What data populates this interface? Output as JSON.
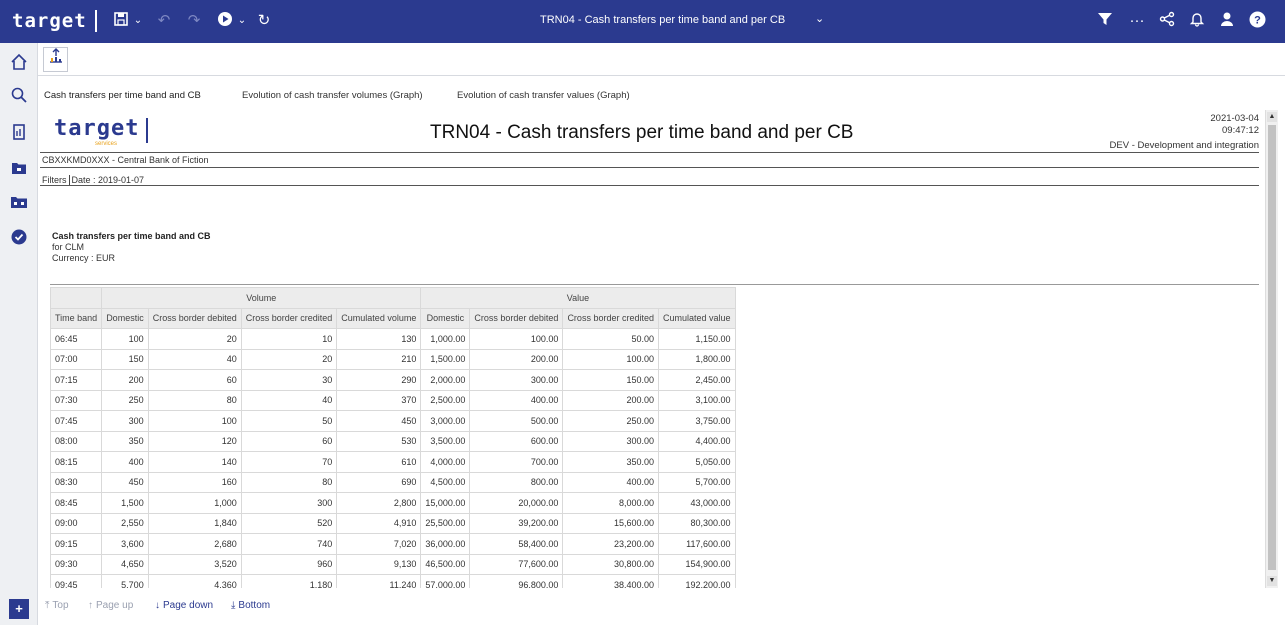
{
  "app": {
    "brand": "target",
    "document_title": "TRN04 - Cash transfers per time band and per CB"
  },
  "toolbar_icons": [
    "save-icon",
    "undo-icon",
    "redo-icon",
    "play-icon",
    "refresh-icon",
    "filter-icon",
    "more-icon",
    "share-icon",
    "bell-icon",
    "user-icon",
    "help-icon"
  ],
  "tabs": [
    {
      "label": "Cash transfers per time band and CB",
      "active": true
    },
    {
      "label": "Evolution of cash transfer volumes (Graph)",
      "active": false
    },
    {
      "label": "Evolution of cash transfer values (Graph)",
      "active": false
    }
  ],
  "report": {
    "logo": "target",
    "logo_sub": "services",
    "title": "TRN04 - Cash transfers per time band and per CB",
    "date": "2021-03-04",
    "time": "09:47:12",
    "environment": "DEV - Development and integration",
    "central_bank": "CBXXKMD0XXX - Central Bank of Fiction",
    "filters_label": "Filters",
    "filters_value": "Date : 2019-01-07",
    "section_title": "Cash transfers per time band and CB",
    "section_for": "for CLM",
    "section_currency": "Currency : EUR"
  },
  "table": {
    "group_headers": [
      "Volume",
      "Value"
    ],
    "columns": [
      "Time band",
      "Domestic",
      "Cross border debited",
      "Cross border credited",
      "Cumulated volume",
      "Domestic",
      "Cross border debited",
      "Cross border credited",
      "Cumulated value"
    ],
    "rows": [
      [
        "06:45",
        "100",
        "20",
        "10",
        "130",
        "1,000.00",
        "100.00",
        "50.00",
        "1,150.00"
      ],
      [
        "07:00",
        "150",
        "40",
        "20",
        "210",
        "1,500.00",
        "200.00",
        "100.00",
        "1,800.00"
      ],
      [
        "07:15",
        "200",
        "60",
        "30",
        "290",
        "2,000.00",
        "300.00",
        "150.00",
        "2,450.00"
      ],
      [
        "07:30",
        "250",
        "80",
        "40",
        "370",
        "2,500.00",
        "400.00",
        "200.00",
        "3,100.00"
      ],
      [
        "07:45",
        "300",
        "100",
        "50",
        "450",
        "3,000.00",
        "500.00",
        "250.00",
        "3,750.00"
      ],
      [
        "08:00",
        "350",
        "120",
        "60",
        "530",
        "3,500.00",
        "600.00",
        "300.00",
        "4,400.00"
      ],
      [
        "08:15",
        "400",
        "140",
        "70",
        "610",
        "4,000.00",
        "700.00",
        "350.00",
        "5,050.00"
      ],
      [
        "08:30",
        "450",
        "160",
        "80",
        "690",
        "4,500.00",
        "800.00",
        "400.00",
        "5,700.00"
      ],
      [
        "08:45",
        "1,500",
        "1,000",
        "300",
        "2,800",
        "15,000.00",
        "20,000.00",
        "8,000.00",
        "43,000.00"
      ],
      [
        "09:00",
        "2,550",
        "1,840",
        "520",
        "4,910",
        "25,500.00",
        "39,200.00",
        "15,600.00",
        "80,300.00"
      ],
      [
        "09:15",
        "3,600",
        "2,680",
        "740",
        "7,020",
        "36,000.00",
        "58,400.00",
        "23,200.00",
        "117,600.00"
      ],
      [
        "09:30",
        "4,650",
        "3,520",
        "960",
        "9,130",
        "46,500.00",
        "77,600.00",
        "30,800.00",
        "154,900.00"
      ],
      [
        "09:45",
        "5,700",
        "4,360",
        "1,180",
        "11,240",
        "57,000.00",
        "96,800.00",
        "38,400.00",
        "192,200.00"
      ]
    ]
  },
  "paging": {
    "top": "Top",
    "page_up": "Page up",
    "page_down": "Page down",
    "bottom": "Bottom"
  }
}
